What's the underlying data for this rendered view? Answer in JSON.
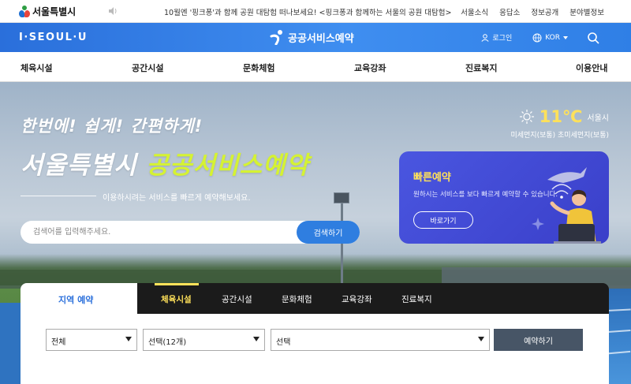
{
  "topbar": {
    "gov_name": "서울특별시",
    "notice": "10월엔 '핑크퐁'과 함께 공원 대탐험 떠나보세요! <핑크퐁과 함께하는 서울의 공원 대탐험>",
    "links": [
      "서울소식",
      "응답소",
      "정보공개",
      "분야별정보"
    ]
  },
  "header": {
    "logo": "I·SEOUL·U",
    "brand": "공공서비스예약",
    "login": "로그인",
    "lang": "KOR"
  },
  "nav": {
    "items": [
      "체육시설",
      "공간시설",
      "문화체험",
      "교육강좌",
      "진료복지",
      "이용안내"
    ]
  },
  "hero": {
    "slogan1": "한번에! 쉽게! 간편하게!",
    "slogan2_prefix": "서울특별시 ",
    "slogan2_highlight": "공공서비스예약",
    "subtitle": "이용하시려는 서비스를 빠르게 예약해보세요.",
    "search_placeholder": "검색어를 입력해주세요.",
    "search_button": "검색하기"
  },
  "weather": {
    "temp": "11℃",
    "city": "서울시",
    "dust": "미세먼지(보통) 초미세먼지(보통)"
  },
  "quick": {
    "title": "빠른예약",
    "desc": "원하시는 서비스를 보다 빠르게 예약할 수 있습니다.",
    "button": "바로가기"
  },
  "reservation": {
    "region_tab": "지역 예약",
    "tabs": [
      "체육시설",
      "공간시설",
      "문화체험",
      "교육강좌",
      "진료복지"
    ],
    "active_tab": "체육시설",
    "select1": "전체",
    "select2": "선택(12개)",
    "select3": "선택",
    "button": "예약하기"
  },
  "colors": {
    "primary_blue": "#2f7ee0",
    "highlight_yellow": "#ffe15a",
    "slogan_green": "#d5f233",
    "quick_card": "#4a56e0"
  }
}
